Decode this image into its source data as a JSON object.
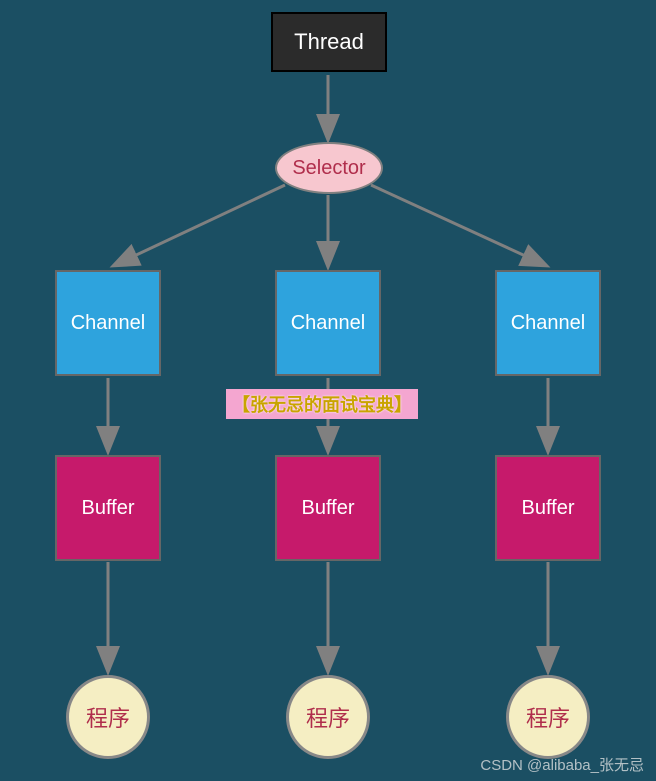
{
  "nodes": {
    "thread": "Thread",
    "selector": "Selector",
    "channel": "Channel",
    "buffer": "Buffer",
    "program": "程序"
  },
  "watermark_badge": "【张无忌的面试宝典】",
  "watermark_text": "CSDN @alibaba_张无忌",
  "colors": {
    "background": "#1b4f63",
    "thread_bg": "#2b2b2b",
    "selector_bg": "#f7c7cf",
    "channel_bg": "#2ea3dd",
    "buffer_bg": "#c61a6b",
    "program_bg": "#f5eec3",
    "arrow": "#808080"
  }
}
